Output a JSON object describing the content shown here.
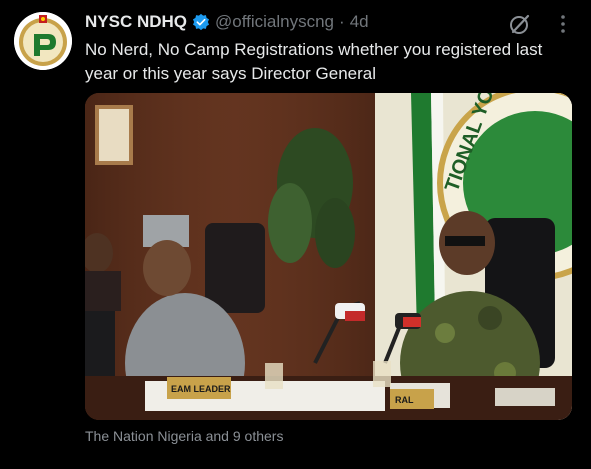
{
  "post": {
    "author_name": "NYSC NDHQ",
    "handle": "@officialnyscng",
    "separator": "·",
    "time": "4d",
    "text": "No Nerd, No Camp Registrations whether you registered last year or this year says Director General",
    "footer": "The Nation Nigeria and 9 others",
    "verified": true
  },
  "media": {
    "emblem_text": "TIONAL YOU",
    "nameplate_left": "EAM LEADER",
    "nameplate_right": "RAL"
  },
  "icons": {
    "verified": "verified-badge-icon",
    "grok": "grok-icon",
    "more": "more-options-icon",
    "avatar": "nysc-logo-avatar"
  },
  "colors": {
    "background": "#000000",
    "text": "#e7e9ea",
    "muted": "#71767b",
    "verified_blue": "#1d9bf0"
  }
}
